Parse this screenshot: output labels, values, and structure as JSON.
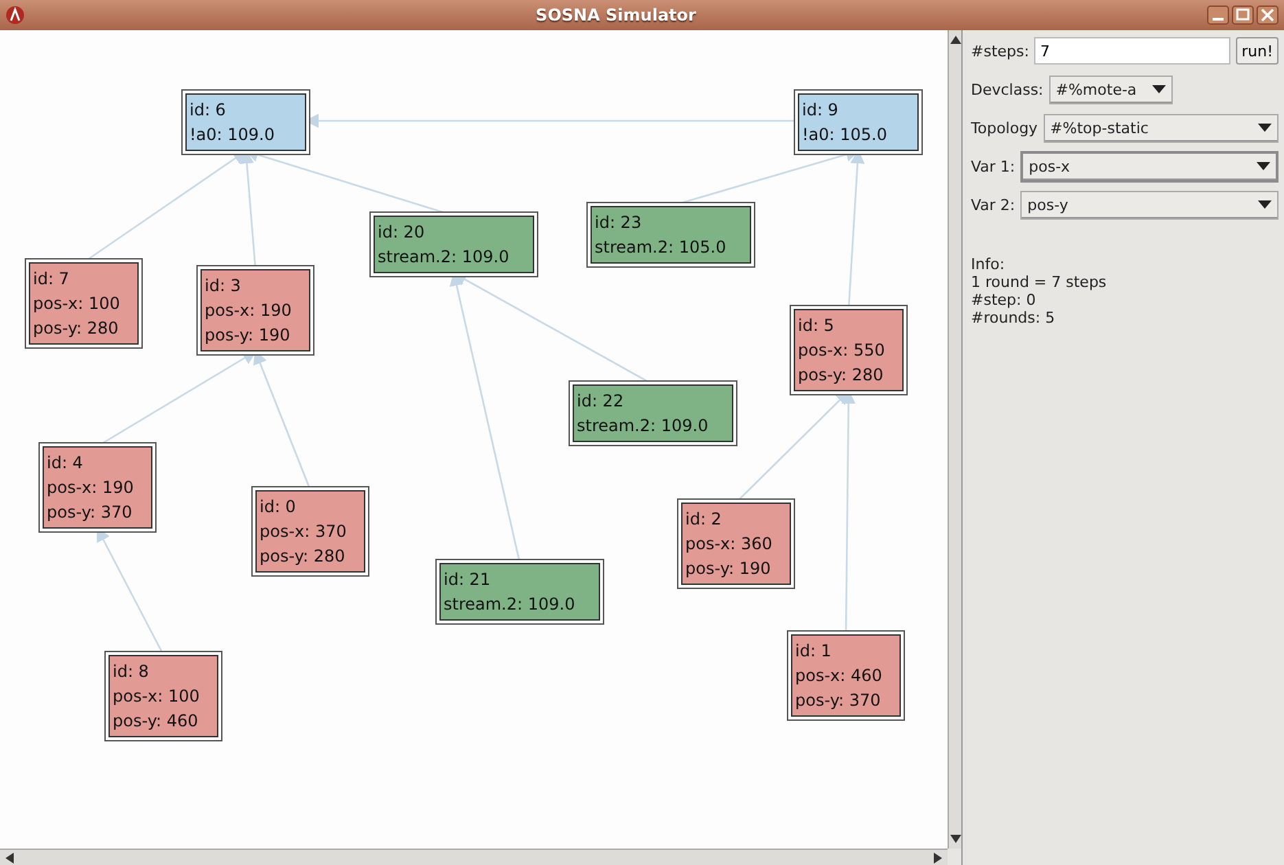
{
  "window": {
    "title": "SOSNA Simulator"
  },
  "nodes": [
    {
      "lines": [
        "id: 6",
        "!a0: 109.0"
      ],
      "color": "#b4d4ea"
    },
    {
      "lines": [
        "id: 9",
        "!a0: 105.0"
      ],
      "color": "#b4d4ea"
    },
    {
      "lines": [
        "id: 20",
        "stream.2: 109.0"
      ],
      "color": "#7fb386"
    },
    {
      "lines": [
        "id: 23",
        "stream.2: 105.0"
      ],
      "color": "#7fb386"
    },
    {
      "lines": [
        "id: 7",
        "pos-x: 100",
        "pos-y: 280"
      ],
      "color": "#e29b94"
    },
    {
      "lines": [
        "id: 3",
        "pos-x: 190",
        "pos-y: 190"
      ],
      "color": "#e29b94"
    },
    {
      "lines": [
        "id: 5",
        "pos-x: 550",
        "pos-y: 280"
      ],
      "color": "#e29b94"
    },
    {
      "lines": [
        "id: 22",
        "stream.2: 109.0"
      ],
      "color": "#7fb386"
    },
    {
      "lines": [
        "id: 4",
        "pos-x: 190",
        "pos-y: 370"
      ],
      "color": "#e29b94"
    },
    {
      "lines": [
        "id: 0",
        "pos-x: 370",
        "pos-y: 280"
      ],
      "color": "#e29b94"
    },
    {
      "lines": [
        "id: 2",
        "pos-x: 360",
        "pos-y: 190"
      ],
      "color": "#e29b94"
    },
    {
      "lines": [
        "id: 21",
        "stream.2: 109.0"
      ],
      "color": "#7fb386"
    },
    {
      "lines": [
        "id: 1",
        "pos-x: 460",
        "pos-y: 370"
      ],
      "color": "#e29b94"
    },
    {
      "lines": [
        "id: 8",
        "pos-x: 100",
        "pos-y: 460"
      ],
      "color": "#e29b94"
    }
  ],
  "panel": {
    "steps_label": "#steps:",
    "steps_value": "7",
    "run_button": "run!",
    "devclass_label": "Devclass:",
    "devclass_value": "#%mote-a",
    "topology_label": "Topology",
    "topology_value": "#%top-static",
    "var1_label": "Var 1:",
    "var1_value": "pos-x",
    "var2_label": "Var 2:",
    "var2_value": "pos-y",
    "info": [
      "Info:",
      "1 round = 7 steps",
      "#step: 0",
      "#rounds: 5"
    ]
  }
}
